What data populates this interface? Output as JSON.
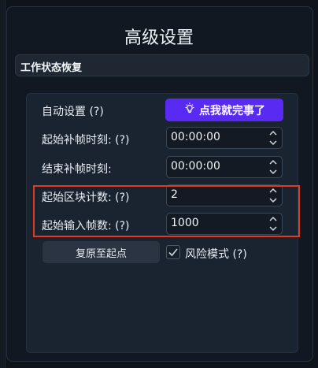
{
  "dialog": {
    "title": "高级设置"
  },
  "section": {
    "header": "工作状态恢复"
  },
  "rows": {
    "auto": {
      "label": "自动设置 (?)",
      "button_label": "点我就完事了"
    },
    "start_frame_time": {
      "label": "起始补帧时刻: (?)",
      "value": "00:00:00"
    },
    "end_frame_time": {
      "label": "结束补帧时刻:",
      "value": "00:00:00"
    },
    "start_block_count": {
      "label": "起始区块计数: (?)",
      "value": "2"
    },
    "start_input_frames": {
      "label": "起始输入帧数: (?)",
      "value": "1000"
    }
  },
  "actions": {
    "reset_label": "复原至起点",
    "risk_mode_label": "风险模式 (?)",
    "risk_mode_checked": true
  },
  "colors": {
    "accent": "#5a2af5",
    "highlight_border": "#e23a1f"
  },
  "icons": {
    "auto_button_icon": "lightbulb-icon",
    "spin_icon": "chevron-up-down-icon",
    "check_icon": "checkmark-icon"
  }
}
